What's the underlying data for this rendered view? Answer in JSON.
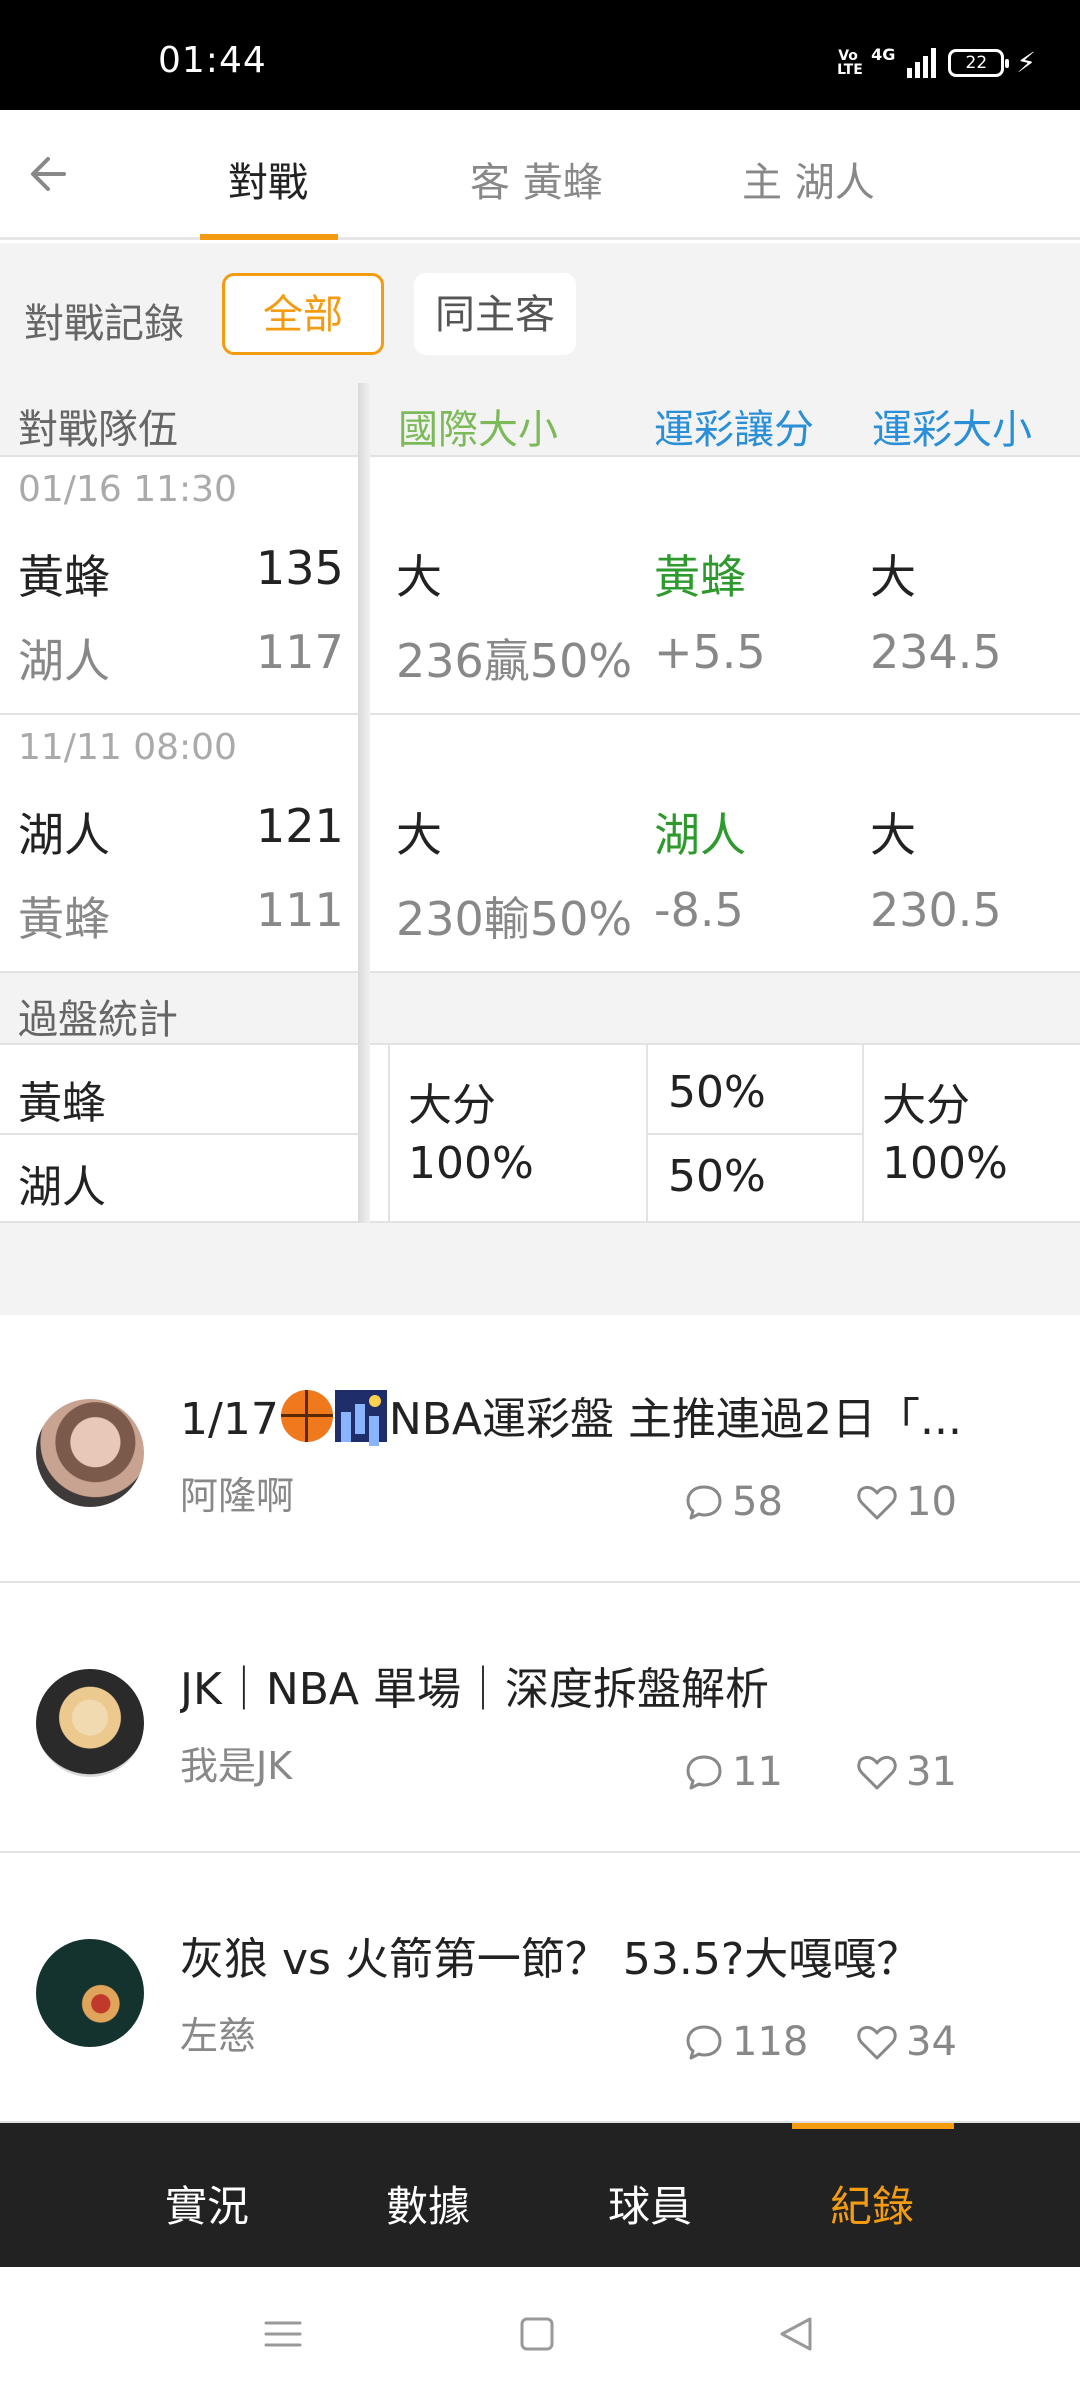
{
  "status_bar": {
    "time": "01:44",
    "volte": "Vo LTE",
    "network": "4G",
    "battery": "22"
  },
  "header": {
    "tabs": [
      {
        "label": "對戰"
      },
      {
        "label": "客 黃蜂"
      },
      {
        "label": "主 湖人"
      }
    ]
  },
  "filter": {
    "label": "對戰記錄",
    "options": [
      "全部",
      "同主客"
    ],
    "selected": "全部"
  },
  "table": {
    "headers": {
      "team": "對戰隊伍",
      "intl_ou": "國際大小",
      "spread": "運彩讓分",
      "total": "運彩大小"
    },
    "colors": {
      "intl_ou": "#7cba59",
      "spread": "#2a8fd6",
      "total": "#2a8fd6"
    },
    "matches": [
      {
        "date": "01/16 11:30",
        "row1": {
          "team": "黃蜂",
          "score": "135",
          "intl": "大",
          "spread": "黃蜂",
          "total": "大"
        },
        "row2": {
          "team": "湖人",
          "score": "117",
          "intl": "236贏50%",
          "spread": "+5.5",
          "total": "234.5"
        }
      },
      {
        "date": "11/11 08:00",
        "row1": {
          "team": "湖人",
          "score": "121",
          "intl": "大",
          "spread": "湖人",
          "total": "大"
        },
        "row2": {
          "team": "黃蜂",
          "score": "111",
          "intl": "230輸50%",
          "spread": "-8.5",
          "total": "230.5"
        }
      }
    ]
  },
  "summary": {
    "title": "過盤統計",
    "teams": [
      "黃蜂",
      "湖人"
    ],
    "intl_label": "大分",
    "intl_pct": "100%",
    "spread_pcts": [
      "50%",
      "50%"
    ],
    "total_label": "大分",
    "total_pct": "100%"
  },
  "posts": [
    {
      "title_prefix": "1/17",
      "title_suffix": "NBA運彩盤 主推連過2日「...",
      "author": "阿隆啊",
      "comments": "58",
      "likes": "10"
    },
    {
      "title": "JK｜NBA 單場｜深度拆盤解析",
      "author": "我是JK",
      "comments": "11",
      "likes": "31"
    },
    {
      "title": "灰狼 vs 火箭第一節？ 53.5?大嘎嘎？",
      "author": "左慈",
      "comments": "118",
      "likes": "34"
    }
  ],
  "bottom_nav": {
    "items": [
      "實況",
      "數據",
      "球員",
      "紀錄"
    ],
    "active": "紀錄",
    "accent": "#f39c12"
  },
  "icons": {
    "back": "arrow-left-icon",
    "comment": "comment-bubble-icon",
    "like": "heart-icon"
  }
}
